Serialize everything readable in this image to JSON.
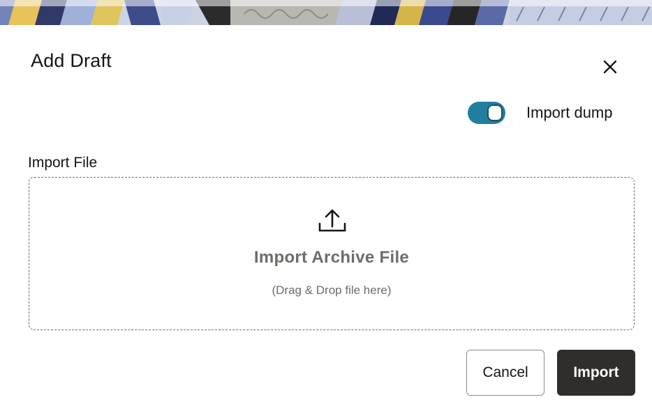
{
  "dialog": {
    "title": "Add Draft",
    "close_icon": "close-icon"
  },
  "import_dump": {
    "label": "Import dump",
    "enabled": true,
    "accent_color": "#227e9e"
  },
  "import_file": {
    "label": "Import File",
    "dropzone_title": "Import Archive File",
    "dropzone_hint": "(Drag & Drop file here)",
    "icon": "upload-icon"
  },
  "actions": {
    "cancel_label": "Cancel",
    "import_label": "Import",
    "primary_color": "#312d2a"
  }
}
